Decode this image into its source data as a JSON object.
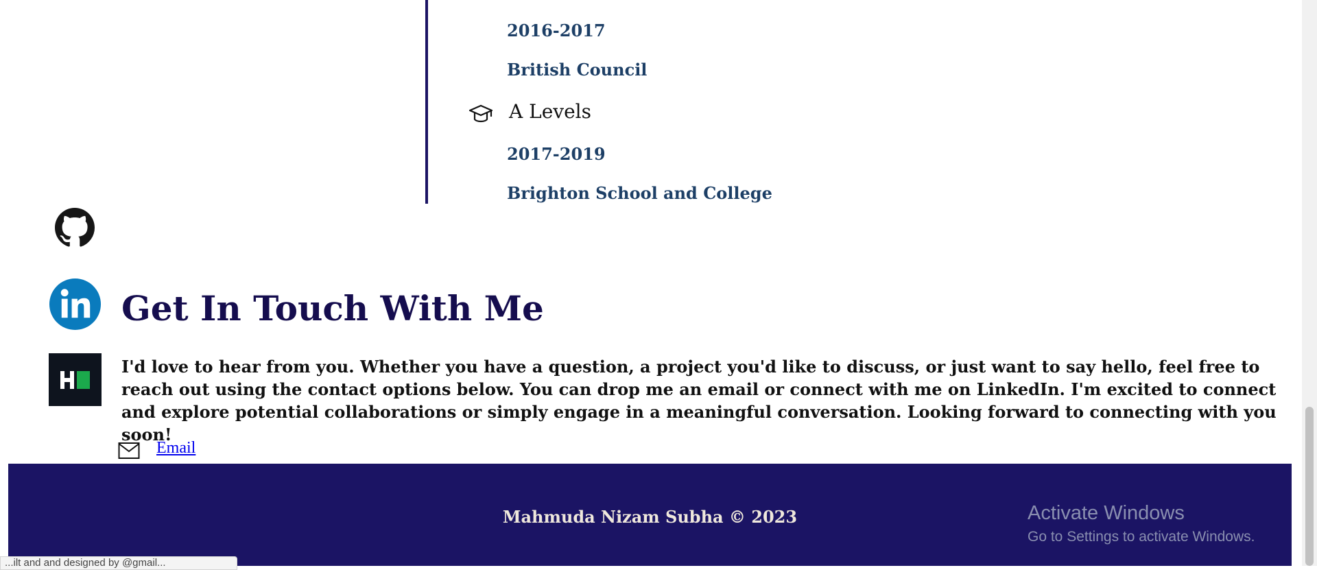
{
  "education": [
    {
      "title": "",
      "date": "2016-2017",
      "school": "British Council"
    },
    {
      "title": "A Levels",
      "date": "2017-2019",
      "school": "Brighton School and College",
      "icon": "graduation-cap-icon"
    }
  ],
  "social": {
    "github": {
      "icon": "github-icon"
    },
    "linkedin": {
      "icon": "linkedin-icon",
      "color": "#0a7bbd"
    },
    "hackerrank": {
      "icon": "hackerrank-icon",
      "color": "#1ba94c"
    }
  },
  "contact": {
    "title": "Get In Touch With Me",
    "text": "I'd love to hear from you. Whether you have a question, a project you'd like to discuss, or just want to say hello, feel free to reach out using the contact options below. You can drop me an email or connect with me on LinkedIn. I'm excited to connect and explore potential collaborations or simply engage in a meaningful conversation. Looking forward to connecting with you soon!",
    "email_label": "Email",
    "email_icon": "mail-icon"
  },
  "footer": {
    "text": "Mahmuda Nizam Subha © 2023",
    "background": "#1b1464"
  },
  "watermark": {
    "title": "Activate Windows",
    "subtitle": "Go to Settings to activate Windows."
  },
  "status": {
    "text": "...ilt and and designed by @gmail..."
  }
}
